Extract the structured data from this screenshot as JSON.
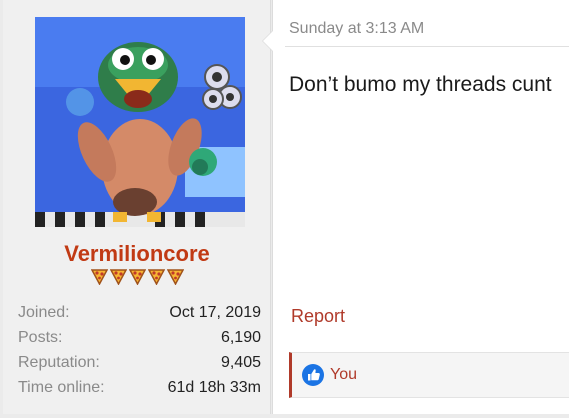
{
  "user": {
    "username": "Vermilioncore",
    "rank_icons": [
      "pizza-icon",
      "pizza-icon",
      "pizza-icon",
      "pizza-icon",
      "pizza-icon"
    ],
    "stats": [
      {
        "label": "Joined:",
        "value": "Oct 17, 2019"
      },
      {
        "label": "Posts:",
        "value": "6,190"
      },
      {
        "label": "Reputation:",
        "value": "9,405"
      },
      {
        "label": "Time online:",
        "value": "61d 18h 33m"
      }
    ]
  },
  "message": {
    "timestamp": "Sunday at 3:13 AM",
    "body": "Don’t bumo my threads cunt",
    "report_label": "Report",
    "likes_label": "You"
  },
  "colors": {
    "username": "#c13a14",
    "accent": "#b03a2a",
    "like_blue": "#1b74e4"
  }
}
